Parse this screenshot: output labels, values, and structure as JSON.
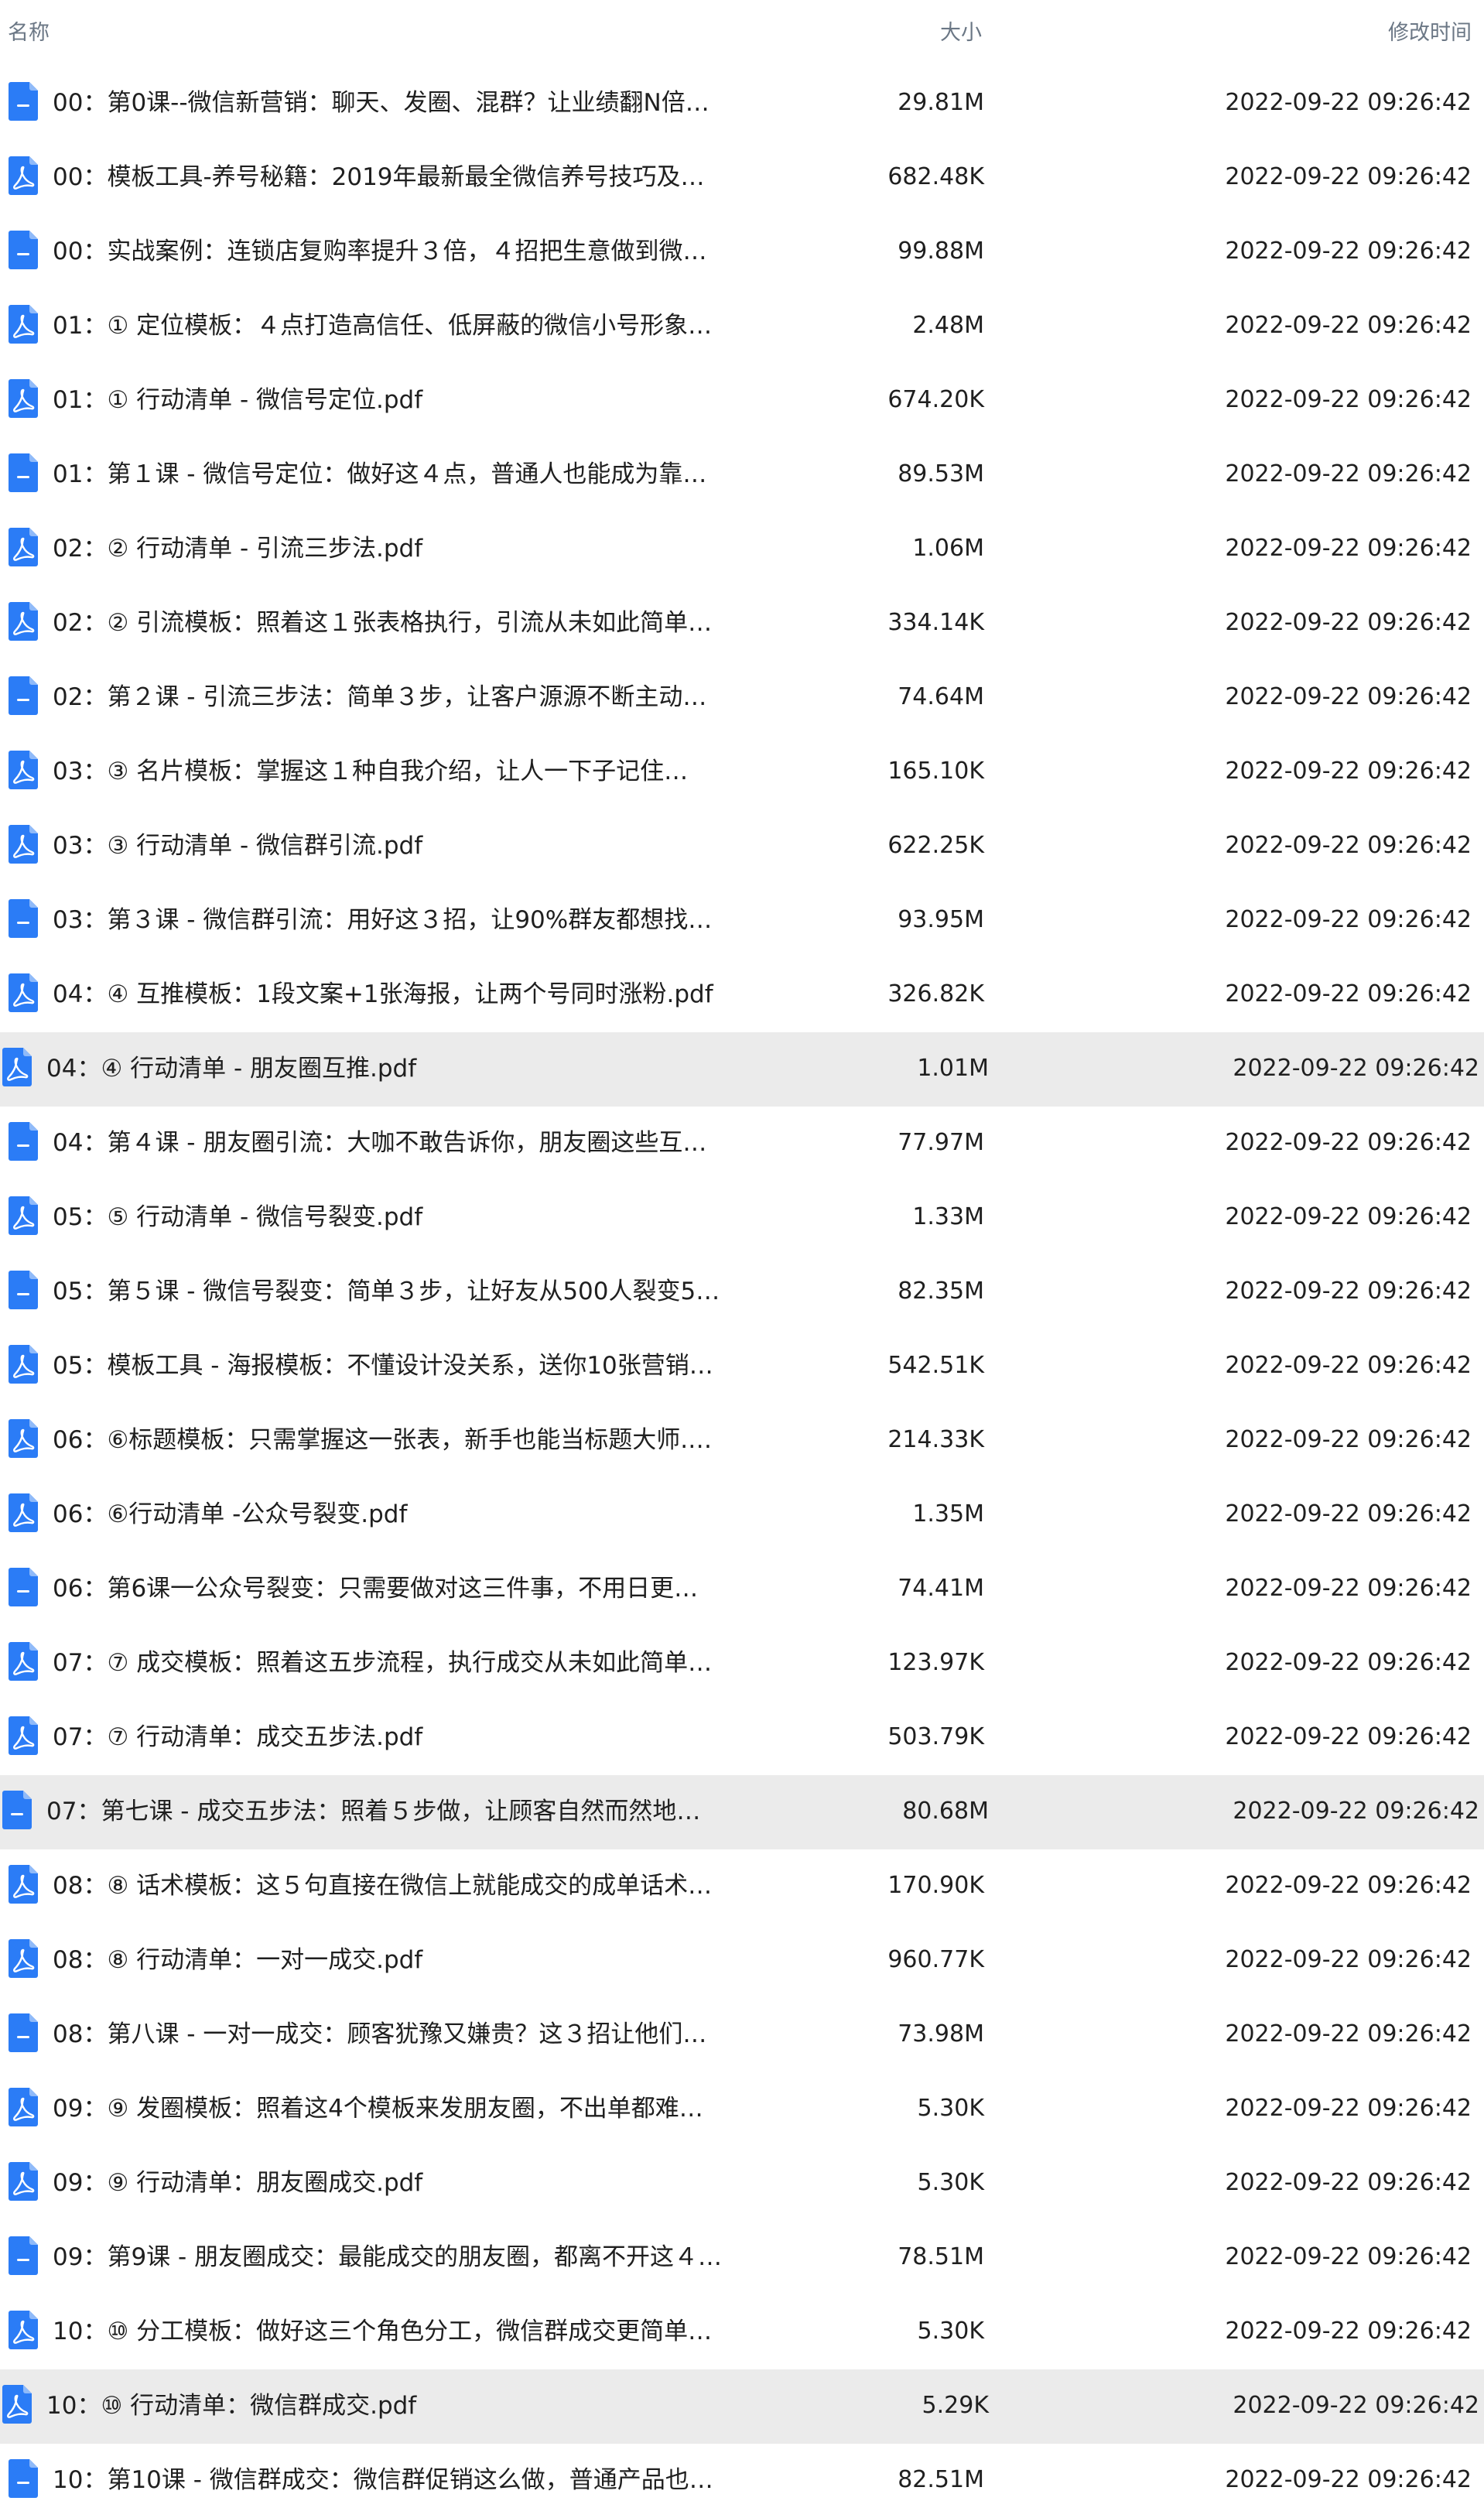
{
  "header": {
    "name": "名称",
    "size": "大小",
    "modified": "修改时间"
  },
  "colors": {
    "icon_blue": "#2b7cf6",
    "selected_row_bg": "#ebebeb",
    "header_text": "#6b7785"
  },
  "files": [
    {
      "name": "00：第0课--微信新营销：聊天、发圈、混群？让业绩翻N倍…",
      "size": "29.81M",
      "modified": "2022-09-22 09:26:42",
      "icon": "doc-icon",
      "selected": false
    },
    {
      "name": "00：模板工具-养号秘籍：2019年最新最全微信养号技巧及…",
      "size": "682.48K",
      "modified": "2022-09-22 09:26:42",
      "icon": "pdf-icon",
      "selected": false
    },
    {
      "name": "00：实战案例：连锁店复购率提升３倍，４招把生意做到微…",
      "size": "99.88M",
      "modified": "2022-09-22 09:26:42",
      "icon": "doc-icon",
      "selected": false
    },
    {
      "name": "01：① 定位模板：４点打造高信任、低屏蔽的微信小号形象…",
      "size": "2.48M",
      "modified": "2022-09-22 09:26:42",
      "icon": "pdf-icon",
      "selected": false
    },
    {
      "name": "01：① 行动清单 - 微信号定位.pdf",
      "size": "674.20K",
      "modified": "2022-09-22 09:26:42",
      "icon": "pdf-icon",
      "selected": false
    },
    {
      "name": "01：第１课 - 微信号定位：做好这４点，普通人也能成为靠…",
      "size": "89.53M",
      "modified": "2022-09-22 09:26:42",
      "icon": "doc-icon",
      "selected": false
    },
    {
      "name": "02：② 行动清单 - 引流三步法.pdf",
      "size": "1.06M",
      "modified": "2022-09-22 09:26:42",
      "icon": "pdf-icon",
      "selected": false
    },
    {
      "name": "02：② 引流模板：照着这１张表格执行，引流从未如此简单…",
      "size": "334.14K",
      "modified": "2022-09-22 09:26:42",
      "icon": "pdf-icon",
      "selected": false
    },
    {
      "name": "02：第２课 - 引流三步法：简单３步，让客户源源不断主动…",
      "size": "74.64M",
      "modified": "2022-09-22 09:26:42",
      "icon": "doc-icon",
      "selected": false
    },
    {
      "name": "03：③ 名片模板：掌握这１种自我介绍，让人一下子记住…",
      "size": "165.10K",
      "modified": "2022-09-22 09:26:42",
      "icon": "pdf-icon",
      "selected": false
    },
    {
      "name": "03：③ 行动清单 - 微信群引流.pdf",
      "size": "622.25K",
      "modified": "2022-09-22 09:26:42",
      "icon": "pdf-icon",
      "selected": false
    },
    {
      "name": "03：第３课 - 微信群引流：用好这３招，让90%群友都想找…",
      "size": "93.95M",
      "modified": "2022-09-22 09:26:42",
      "icon": "doc-icon",
      "selected": false
    },
    {
      "name": "04：④ 互推模板：1段文案+1张海报，让两个号同时涨粉.pdf",
      "size": "326.82K",
      "modified": "2022-09-22 09:26:42",
      "icon": "pdf-icon",
      "selected": false
    },
    {
      "name": "04：④ 行动清单 - 朋友圈互推.pdf",
      "size": "1.01M",
      "modified": "2022-09-22 09:26:42",
      "icon": "pdf-icon",
      "selected": true
    },
    {
      "name": "04：第４课 - 朋友圈引流：大咖不敢告诉你，朋友圈这些互…",
      "size": "77.97M",
      "modified": "2022-09-22 09:26:42",
      "icon": "doc-icon",
      "selected": false
    },
    {
      "name": "05：⑤ 行动清单 - 微信号裂变.pdf",
      "size": "1.33M",
      "modified": "2022-09-22 09:26:42",
      "icon": "pdf-icon",
      "selected": false
    },
    {
      "name": "05：第５课 - 微信号裂变：简单３步，让好友从500人裂变5…",
      "size": "82.35M",
      "modified": "2022-09-22 09:26:42",
      "icon": "doc-icon",
      "selected": false
    },
    {
      "name": "05：模板工具 - 海报模板：不懂设计没关系，送你10张营销…",
      "size": "542.51K",
      "modified": "2022-09-22 09:26:42",
      "icon": "pdf-icon",
      "selected": false
    },
    {
      "name": "06：⑥标题模板：只需掌握这一张表，新手也能当标题大师.…",
      "size": "214.33K",
      "modified": "2022-09-22 09:26:42",
      "icon": "pdf-icon",
      "selected": false
    },
    {
      "name": "06：⑥行动清单 -公众号裂变.pdf",
      "size": "1.35M",
      "modified": "2022-09-22 09:26:42",
      "icon": "pdf-icon",
      "selected": false
    },
    {
      "name": "06：第6课一公众号裂变：只需要做对这三件事，不用日更…",
      "size": "74.41M",
      "modified": "2022-09-22 09:26:42",
      "icon": "doc-icon",
      "selected": false
    },
    {
      "name": "07：⑦ 成交模板：照着这五步流程，执行成交从未如此简单…",
      "size": "123.97K",
      "modified": "2022-09-22 09:26:42",
      "icon": "pdf-icon",
      "selected": false
    },
    {
      "name": "07：⑦ 行动清单：成交五步法.pdf",
      "size": "503.79K",
      "modified": "2022-09-22 09:26:42",
      "icon": "pdf-icon",
      "selected": false
    },
    {
      "name": "07：第七课 - 成交五步法：照着５步做，让顾客自然而然地…",
      "size": "80.68M",
      "modified": "2022-09-22 09:26:42",
      "icon": "doc-icon",
      "selected": true
    },
    {
      "name": "08：⑧ 话术模板：这５句直接在微信上就能成交的成单话术…",
      "size": "170.90K",
      "modified": "2022-09-22 09:26:42",
      "icon": "pdf-icon",
      "selected": false
    },
    {
      "name": "08：⑧ 行动清单：一对一成交.pdf",
      "size": "960.77K",
      "modified": "2022-09-22 09:26:42",
      "icon": "pdf-icon",
      "selected": false
    },
    {
      "name": "08：第八课 - 一对一成交：顾客犹豫又嫌贵？这３招让他们…",
      "size": "73.98M",
      "modified": "2022-09-22 09:26:42",
      "icon": "doc-icon",
      "selected": false
    },
    {
      "name": "09：⑨ 发圈模板：照着这4个模板来发朋友圈，不出单都难…",
      "size": "5.30K",
      "modified": "2022-09-22 09:26:42",
      "icon": "pdf-icon",
      "selected": false
    },
    {
      "name": "09：⑨ 行动清单：朋友圈成交.pdf",
      "size": "5.30K",
      "modified": "2022-09-22 09:26:42",
      "icon": "pdf-icon",
      "selected": false
    },
    {
      "name": "09：第9课 - 朋友圈成交：最能成交的朋友圈，都离不开这４…",
      "size": "78.51M",
      "modified": "2022-09-22 09:26:42",
      "icon": "doc-icon",
      "selected": false
    },
    {
      "name": "10：⑩ 分工模板：做好这三个角色分工，微信群成交更简单…",
      "size": "5.30K",
      "modified": "2022-09-22 09:26:42",
      "icon": "pdf-icon",
      "selected": false
    },
    {
      "name": "10：⑩ 行动清单：微信群成交.pdf",
      "size": "5.29K",
      "modified": "2022-09-22 09:26:42",
      "icon": "pdf-icon",
      "selected": true
    },
    {
      "name": "10：第10课 - 微信群成交：微信群促销这么做，普通产品也…",
      "size": "82.51M",
      "modified": "2022-09-22 09:26:42",
      "icon": "doc-icon",
      "selected": false
    }
  ]
}
